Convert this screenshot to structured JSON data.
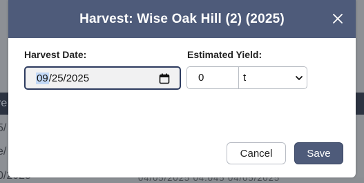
{
  "background": {
    "cells": [
      "re",
      "5/",
      "e/",
      "0/2025"
    ],
    "bottom_text": "04/05/2025      04.045      04/05/2025"
  },
  "modal": {
    "title": "Harvest: Wise Oak Hill (2) (2025)",
    "close_icon": "close-icon",
    "harvest_date": {
      "label": "Harvest Date:",
      "month": "09",
      "rest": "/25/2025",
      "icon": "calendar-icon"
    },
    "estimated_yield": {
      "label": "Estimated Yield:",
      "value": "0",
      "unit": "t",
      "icon": "chevron-down-icon"
    },
    "buttons": {
      "cancel": "Cancel",
      "save": "Save"
    }
  },
  "colors": {
    "header": "#4e5b7a",
    "save_button": "#4e5b7a",
    "focus_border": "#2c3a5e",
    "date_highlight": "#c3d9f7"
  }
}
